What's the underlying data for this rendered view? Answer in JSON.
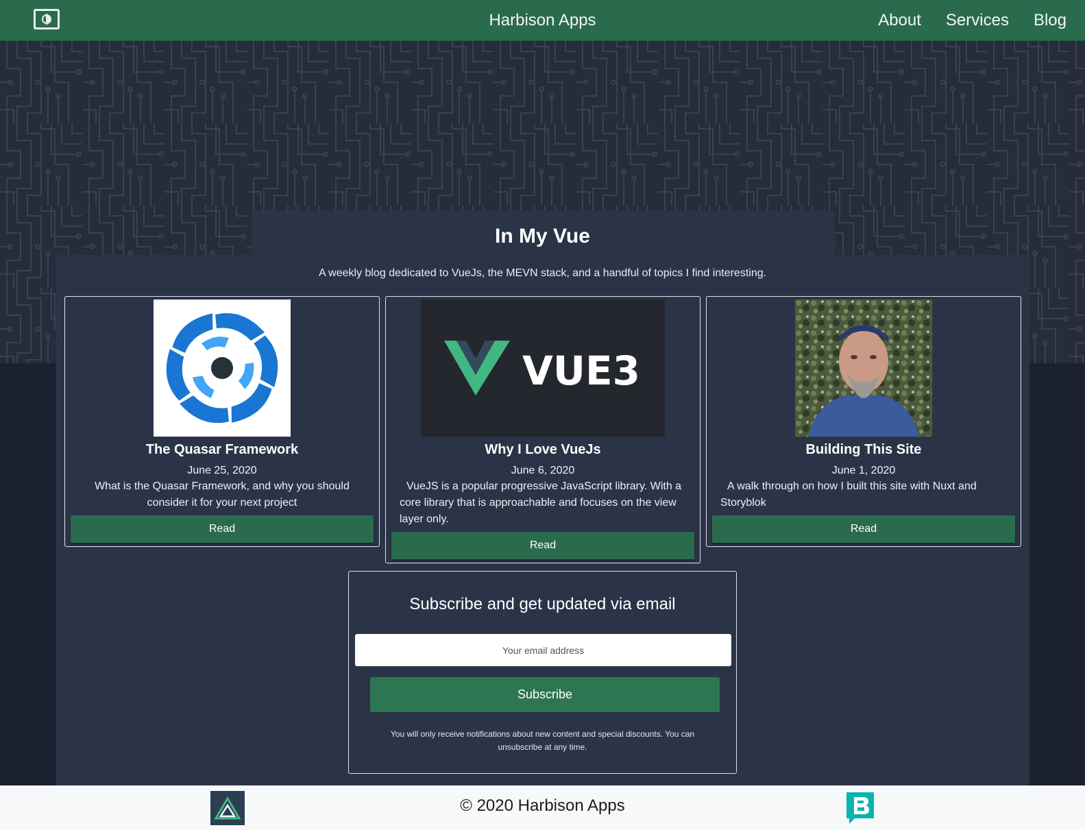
{
  "header": {
    "brand": "Harbison Apps",
    "nav": [
      "About",
      "Services",
      "Blog"
    ],
    "theme_toggle_icon": "contrast-toggle-icon"
  },
  "main": {
    "title": "In My Vue",
    "tagline": "A weekly blog dedicated to VueJs, the MEVN stack, and a handful of topics I find interesting."
  },
  "posts": [
    {
      "title": "The Quasar Framework",
      "date": "June 25, 2020",
      "excerpt": "What is the Quasar Framework, and why you should consider it for your next project",
      "button": "Read",
      "image": "quasar-logo"
    },
    {
      "title": "Why I Love VueJs",
      "date": "June 6, 2020",
      "excerpt": "VueJS is a popular progressive JavaScript library. With a core library that is approachable and focuses on the view layer only.",
      "button": "Read",
      "image": "vue3-banner",
      "image_text": "VUE3"
    },
    {
      "title": "Building This Site",
      "date": "June 1, 2020",
      "excerpt": "A walk through on how I built this site with Nuxt and Storyblok",
      "button": "Read",
      "image": "author-photo"
    }
  ],
  "subscribe": {
    "heading": "Subscribe and get updated via email",
    "placeholder": "Your email address",
    "button": "Subscribe",
    "fine_print": "You will only receive notifications about new content and special discounts. You can unsubscribe at any time."
  },
  "footer": {
    "copyright": "© 2020 Harbison Apps",
    "left_logo": "nuxt-logo",
    "right_logo": "storyblok-logo"
  },
  "colors": {
    "header_green": "#2b6b4d",
    "panel": "#2b3447",
    "page_bg": "#1c2130",
    "footer_bg": "#f7f8fa"
  }
}
